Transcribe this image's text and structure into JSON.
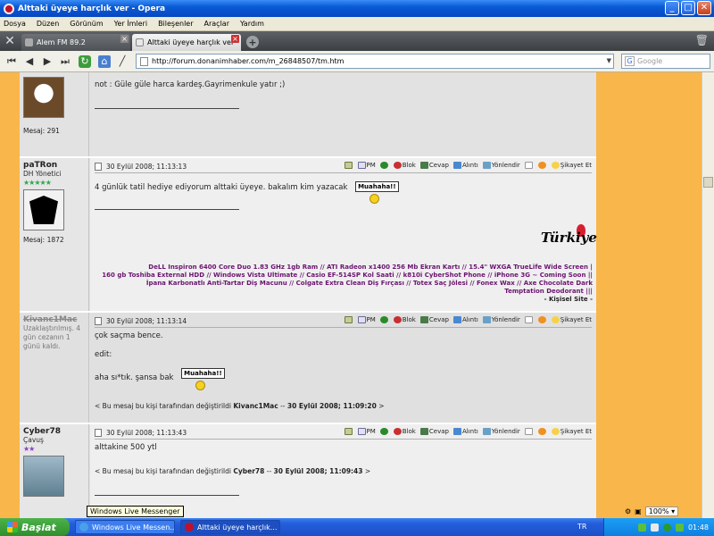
{
  "window": {
    "title": "Alttaki üyeye harçlık ver - Opera"
  },
  "menu": [
    "Dosya",
    "Düzen",
    "Görünüm",
    "Yer İmleri",
    "Bileşenler",
    "Araçlar",
    "Yardım"
  ],
  "tabs": [
    {
      "label": "Alem FM 89.2",
      "active": false
    },
    {
      "label": "Alttaki üyeye harçlık ver",
      "active": true
    }
  ],
  "address": {
    "url": "http://forum.donanimhaber.com/m_26848507/tm.htm"
  },
  "search": {
    "placeholder": "Google"
  },
  "posts": [
    {
      "mesaj": "Mesaj: 291",
      "text": "not : Güle güle harca kardeş.Gayrimenkule yatır ;)"
    },
    {
      "username": "paTRon",
      "title": "DH Yönetici",
      "stars": "★★★★★",
      "mesaj": "Mesaj: 1872",
      "date": "30 Eylül 2008; 11:13:13",
      "text": "4 günlük tatil hediye ediyorum alttaki üyeye. bakalım kim yazacak",
      "smiley": "Muahaha!!",
      "sig_logo": "Türkiye",
      "sig_lines": [
        "DeLL Inspiron 6400 Core Duo 1.83 GHz 1gb Ram // ATI Radeon x1400 256 Mb Ekran Kartı // 15.4\" WXGA TrueLife Wide Screen |",
        "160 gb Toshiba External HDD // Windows Vista Ultimate // Casio EF-514SP Kol Saati // k810i CyberShot Phone // iPhone 3G ~ Coming Soon ||",
        "İpana Karbonatlı Anti-Tartar Diş Macunu // Colgate Extra Clean Diş Fırçası // Totex Saç Jölesi // Fonex Wax // Axe Chocolate Dark",
        "Temptation Deodorant |||"
      ],
      "sig_site": "- Kişisel Site -"
    },
    {
      "username": "Kivanc1Mac",
      "title": "Uzaklaştırılmış. 4 gün cezanın 1 günü kaldı.",
      "date": "30 Eylül 2008; 11:13:14",
      "line1": "çok saçma bence.",
      "line2": "edit:",
      "line3": "aha sı*tık. şansa bak",
      "smiley": "Muahaha!!",
      "edit_prefix": "< Bu mesaj bu kişi tarafından değiştirildi ",
      "edit_user": "Kivanc1Mac",
      "edit_sep": " -- ",
      "edit_date": "30 Eylül 2008; 11:09:20",
      "edit_suffix": " >"
    },
    {
      "username": "Cyber78",
      "title": "Çavuş",
      "stars": "★★",
      "date": "30 Eylül 2008; 11:13:43",
      "text": "alttakine 500 ytl",
      "edit_prefix": "< Bu mesaj bu kişi tarafından değiştirildi ",
      "edit_user": "Cyber78",
      "edit_sep": " -- ",
      "edit_date": "30 Eylül 2008; 11:09:43",
      "edit_suffix": " >"
    }
  ],
  "actions": {
    "pm": "PM",
    "blok": "Blok",
    "cevap": "Cevap",
    "alinti": "Alıntı",
    "yonlendir": "Yönlendir",
    "sikayet": "Şikayet Et"
  },
  "statusbar": {
    "zoom": "100%"
  },
  "tooltip": "Windows Live Messenger",
  "taskbar": {
    "start": "Başlat",
    "tasks": [
      "Windows Live Messen...",
      "Alttaki üyeye harçlık..."
    ],
    "lang": "TR",
    "clock": "01:48"
  }
}
